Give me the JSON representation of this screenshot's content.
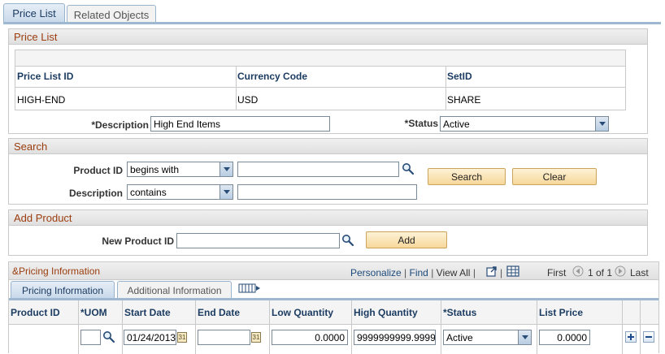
{
  "page_tabs": [
    {
      "label": "Price List",
      "active": true
    },
    {
      "label": "Related Objects",
      "active": false
    }
  ],
  "price_list_group": {
    "title": "Price List",
    "headers": [
      "Price List ID",
      "Currency Code",
      "SetID"
    ],
    "values": [
      "HIGH-END",
      "USD",
      "SHARE"
    ],
    "description_label": "*Description",
    "description_value": "High End Items",
    "status_label": "*Status",
    "status_value": "Active"
  },
  "search_group": {
    "title": "Search",
    "product_id_label": "Product ID",
    "product_id_operator": "begins with",
    "product_id_value": "",
    "description_label": "Description",
    "description_operator": "contains",
    "description_value": "",
    "search_button": "Search",
    "clear_button": "Clear"
  },
  "add_product_group": {
    "title": "Add Product",
    "new_product_label": "New Product ID",
    "new_product_value": "",
    "add_button": "Add"
  },
  "pricing": {
    "title": "&Pricing Information",
    "nav": {
      "personalize": "Personalize",
      "find": "Find",
      "view_all": "View All",
      "first": "First",
      "range": "1 of 1",
      "last": "Last"
    },
    "subtabs": [
      {
        "label": "Pricing Information",
        "active": true
      },
      {
        "label": "Additional Information",
        "active": false
      }
    ],
    "columns": [
      "Product ID",
      "*UOM",
      "Start Date",
      "End Date",
      "Low Quantity",
      "High Quantity",
      "*Status",
      "List Price"
    ],
    "row": {
      "product_id": "",
      "uom": "",
      "start_date": "01/24/2013",
      "end_date": "",
      "low_quantity": "0.0000",
      "high_quantity": "9999999999.9999",
      "status": "Active",
      "list_price": "0.0000"
    }
  },
  "colors": {
    "group_title": "#9b3d0e",
    "header_text": "#1c3c62",
    "button_bg": "#f7d79a"
  }
}
